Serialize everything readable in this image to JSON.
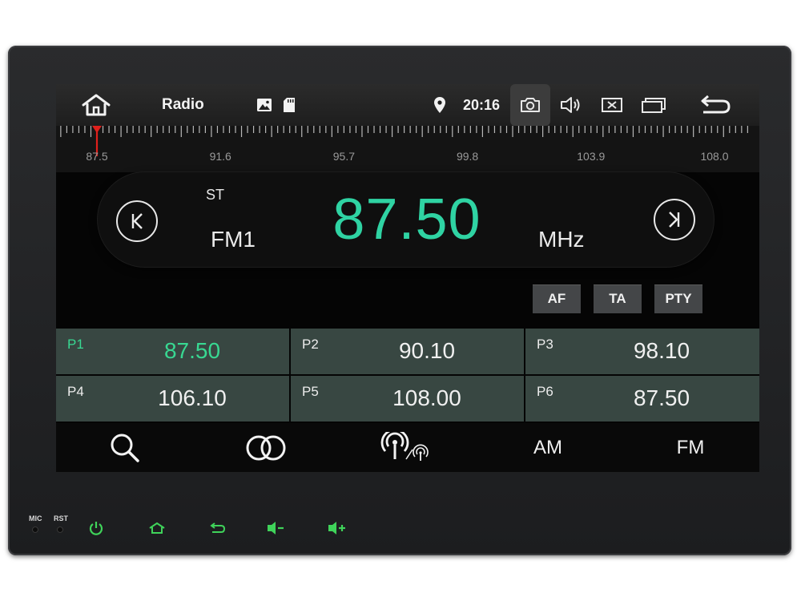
{
  "status_bar": {
    "title": "Radio",
    "time": "20:16",
    "icons": [
      "home-icon",
      "image-icon",
      "sd-card-icon",
      "location-icon",
      "camera-icon",
      "volume-icon",
      "close-window-icon",
      "recent-apps-icon",
      "back-icon"
    ]
  },
  "tuner": {
    "ticks": [
      "87.5",
      "91.6",
      "95.7",
      "99.8",
      "103.9",
      "108.0"
    ],
    "indicator_value": 87.5,
    "indicator_color": "#e0201c"
  },
  "display": {
    "stereo": "ST",
    "band": "FM1",
    "frequency": "87.50",
    "unit": "MHz",
    "frequency_color": "#2fd3a3"
  },
  "rds_buttons": [
    "AF",
    "TA",
    "PTY"
  ],
  "presets": [
    {
      "label": "P1",
      "freq": "87.50",
      "active": true
    },
    {
      "label": "P2",
      "freq": "90.10",
      "active": false
    },
    {
      "label": "P3",
      "freq": "98.10",
      "active": false
    },
    {
      "label": "P4",
      "freq": "106.10",
      "active": false
    },
    {
      "label": "P5",
      "freq": "108.00",
      "active": false
    },
    {
      "label": "P6",
      "freq": "87.50",
      "active": false
    }
  ],
  "function_bar": {
    "icons": [
      "search-icon",
      "stereo-icon",
      "local-distance-icon"
    ],
    "am_label": "AM",
    "fm_label": "FM"
  },
  "hardware": {
    "mic_label": "MIC",
    "rst_label": "RST",
    "button_color": "#3fd35a",
    "buttons": [
      "power-icon",
      "home-icon",
      "back-icon",
      "volume-down-icon",
      "volume-up-icon"
    ]
  }
}
